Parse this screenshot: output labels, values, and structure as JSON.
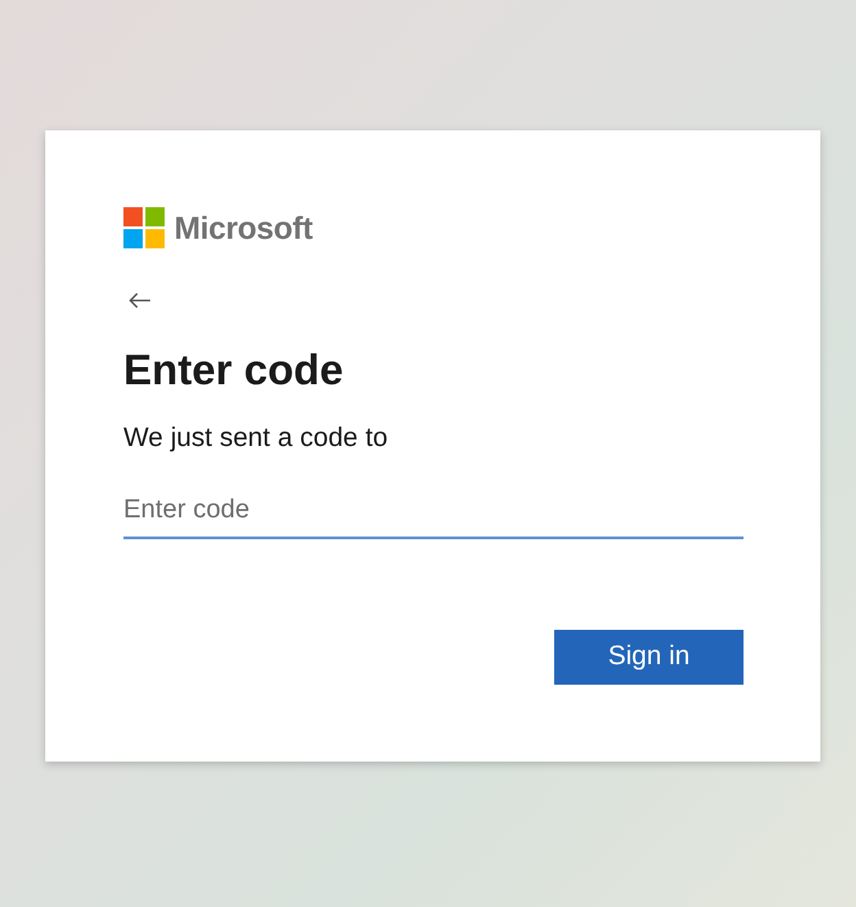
{
  "logo": {
    "wordmark": "Microsoft"
  },
  "title": "Enter code",
  "message": "We just sent a code to",
  "code_field": {
    "placeholder": "Enter code",
    "focused": true
  },
  "buttons": [
    {
      "label": "Sign in",
      "kind": "primary"
    }
  ]
}
